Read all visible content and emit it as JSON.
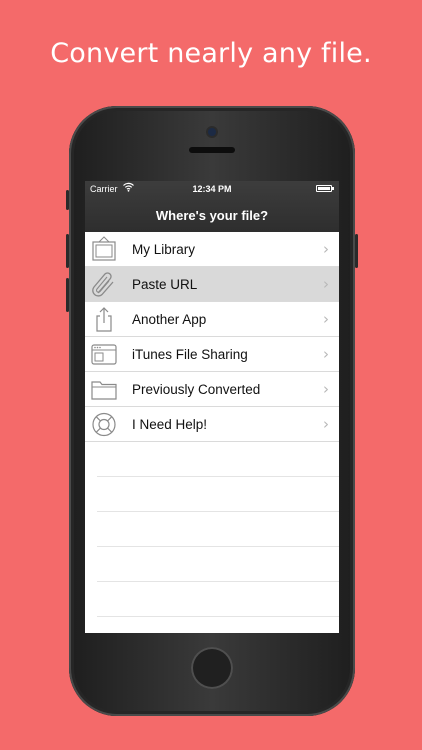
{
  "headline": "Convert nearly any file.",
  "status_bar": {
    "carrier": "Carrier",
    "time": "12:34 PM",
    "wifi_icon": "wifi-icon",
    "battery_icon": "battery-icon"
  },
  "nav": {
    "title": "Where's your file?"
  },
  "menu": {
    "items": [
      {
        "label": "My Library",
        "icon": "picture-frame-icon",
        "chevron": "›"
      },
      {
        "label": "Paste URL",
        "icon": "paperclip-icon",
        "chevron": "›",
        "selected": true
      },
      {
        "label": "Another App",
        "icon": "share-icon",
        "chevron": "›"
      },
      {
        "label": "iTunes File Sharing",
        "icon": "window-icon",
        "chevron": "›"
      },
      {
        "label": "Previously Converted",
        "icon": "folder-icon",
        "chevron": "›"
      },
      {
        "label": "I Need Help!",
        "icon": "lifebuoy-icon",
        "chevron": "›"
      }
    ]
  },
  "colors": {
    "background": "#f46a6a",
    "navbar": "#333333",
    "selected_row": "#d9d9d9"
  }
}
